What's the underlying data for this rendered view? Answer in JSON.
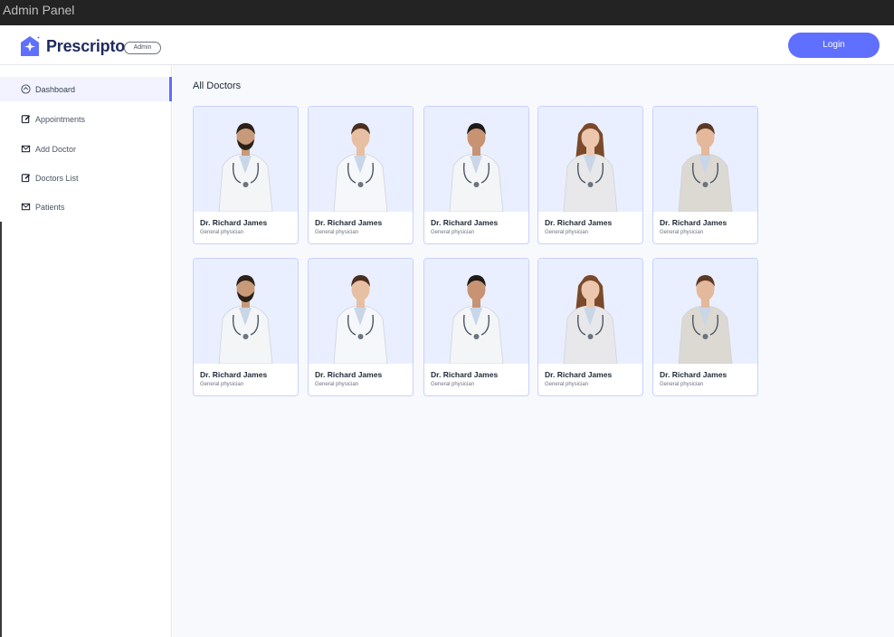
{
  "window": {
    "title": "Admin Panel"
  },
  "header": {
    "brand": "Prescripto",
    "badge": "Admin",
    "login_label": "Login"
  },
  "sidebar": {
    "items": [
      {
        "label": "Dashboard",
        "icon": "home-icon",
        "active": true
      },
      {
        "label": "Appointments",
        "icon": "calendar-edit-icon",
        "active": false
      },
      {
        "label": "Add Doctor",
        "icon": "add-doctor-icon",
        "active": false
      },
      {
        "label": "Doctors List",
        "icon": "list-edit-icon",
        "active": false
      },
      {
        "label": "Patients",
        "icon": "patients-icon",
        "active": false
      }
    ]
  },
  "main": {
    "title": "All Doctors",
    "doctors": [
      {
        "name": "Dr. Richard James",
        "speciality": "General physician"
      },
      {
        "name": "Dr. Richard James",
        "speciality": "General physician"
      },
      {
        "name": "Dr. Richard James",
        "speciality": "General physician"
      },
      {
        "name": "Dr. Richard James",
        "speciality": "General physician"
      },
      {
        "name": "Dr. Richard James",
        "speciality": "General physician"
      },
      {
        "name": "Dr. Richard James",
        "speciality": "General physician"
      },
      {
        "name": "Dr. Richard James",
        "speciality": "General physician"
      },
      {
        "name": "Dr. Richard James",
        "speciality": "General physician"
      },
      {
        "name": "Dr. Richard James",
        "speciality": "General physician"
      },
      {
        "name": "Dr. Richard James",
        "speciality": "General physician"
      }
    ]
  },
  "colors": {
    "accent": "#5f6fff",
    "brand_text": "#1e2a5e",
    "card_bg": "#eaefff"
  }
}
